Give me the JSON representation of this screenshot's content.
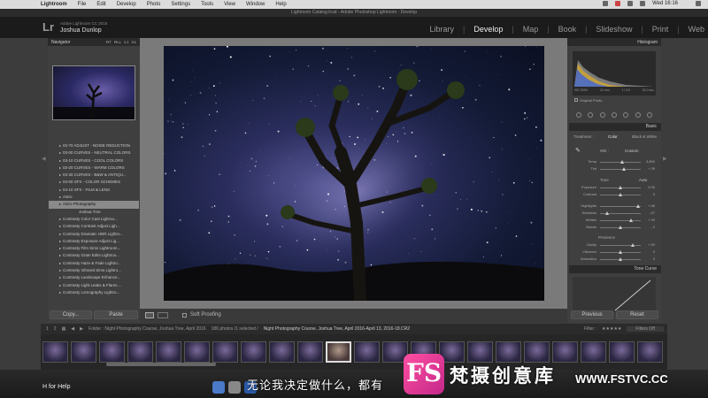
{
  "menubar": {
    "app": "Lightroom",
    "items": [
      "File",
      "Edit",
      "Develop",
      "Photo",
      "Settings",
      "Tools",
      "View",
      "Window",
      "Help"
    ],
    "clock": "Wed 16:16"
  },
  "titlebar": {
    "title": "Lightroom Catalog.lrcat - Adobe Photoshop Lightroom - Develop"
  },
  "identity": {
    "logo": "Lr",
    "product": "Adobe Lightroom CC 2015",
    "user": "Joshua Dunlop"
  },
  "modules": [
    {
      "label": "Library"
    },
    {
      "label": "Develop"
    },
    {
      "label": "Map"
    },
    {
      "label": "Book"
    },
    {
      "label": "Slideshow"
    },
    {
      "label": "Print"
    },
    {
      "label": "Web"
    }
  ],
  "navigator": {
    "title": "Navigator",
    "zoom_options": [
      "FIT",
      "FILL",
      "1:1",
      "3:1"
    ]
  },
  "presets": [
    {
      "label": "02-70 ADJUST - NOISE REDUCTION",
      "type": "folder"
    },
    {
      "label": "03-00 CURVES - NEUTRAL COLORS",
      "type": "folder"
    },
    {
      "label": "03-10 CURVES - COOL COLORS",
      "type": "folder"
    },
    {
      "label": "03-20 CURVES - WARM COLORS",
      "type": "folder"
    },
    {
      "label": "03-30 CURVES - B&W & ANTIQU...",
      "type": "folder"
    },
    {
      "label": "04-00 SFX - COLOR SCHEMES",
      "type": "folder"
    },
    {
      "label": "04-10 SFX - FILM & LENS",
      "type": "folder"
    },
    {
      "label": "Astro",
      "type": "folder"
    },
    {
      "label": "Astro Photography",
      "type": "selected"
    },
    {
      "label": "Joshua Tree",
      "type": "child"
    },
    {
      "label": "Contrasty Color Cast Lighroo...",
      "type": "folder"
    },
    {
      "label": "Contrasty Contrast Adjust Ligh...",
      "type": "folder"
    },
    {
      "label": "Contrasty Dramatic HDR Lightro...",
      "type": "folder"
    },
    {
      "label": "Contrasty Exposure Adjust Lig...",
      "type": "folder"
    },
    {
      "label": "Contrasty Film Sims Lightroom...",
      "type": "folder"
    },
    {
      "label": "Contrasty Grain Edits Lightroo...",
      "type": "folder"
    },
    {
      "label": "Contrasty Haze & Fade Lightro...",
      "type": "folder"
    },
    {
      "label": "Contrasty Infrared Sims Lightro...",
      "type": "folder"
    },
    {
      "label": "Contrasty Landscape Enhance...",
      "type": "folder"
    },
    {
      "label": "Contrasty Light Leaks & Flares ...",
      "type": "folder"
    },
    {
      "label": "Contrasty Lomography Lightro...",
      "type": "folder"
    }
  ],
  "left_buttons": {
    "copy": "Copy...",
    "paste": "Paste"
  },
  "toolbar": {
    "soft_proofing": "Soft Proofing"
  },
  "right": {
    "histogram_title": "Histogram",
    "hist_info": [
      "ISO 3200",
      "14 mm",
      "f / 2.8",
      "30.0 sec"
    ],
    "original_photo": "Original Photo",
    "basic_title": "Basic",
    "treatment_label": "Treatment :",
    "treatment_color": "Color",
    "treatment_bw": "Black & White",
    "wb_label": "WB :",
    "wb_value": "Custom",
    "tone_label": "Tone",
    "tone_auto": "Auto",
    "presence_label": "Presence",
    "tone_curve_title": "Tone Curve",
    "previous": "Previous",
    "reset": "Reset"
  },
  "sliders": [
    {
      "label": "Temp",
      "value": "3,800",
      "pos": 0.55
    },
    {
      "label": "Tint",
      "value": "+ 29",
      "pos": 0.58
    },
    {
      "label": "Exposure",
      "value": "0.00",
      "pos": 0.5
    },
    {
      "label": "Contrast",
      "value": "0",
      "pos": 0.5
    },
    {
      "label": "Highlights",
      "value": "+ 86",
      "pos": 0.93
    },
    {
      "label": "Shadows",
      "value": "- 67",
      "pos": 0.17
    },
    {
      "label": "Whites",
      "value": "+ 49",
      "pos": 0.75
    },
    {
      "label": "Blacks",
      "value": "- 2",
      "pos": 0.49
    },
    {
      "label": "Clarity",
      "value": "+ 60",
      "pos": 0.8
    },
    {
      "label": "Vibrance",
      "value": "0",
      "pos": 0.5
    },
    {
      "label": "Saturation",
      "value": "0",
      "pos": 0.5
    }
  ],
  "filmstrip": {
    "pages": [
      "1",
      "2"
    ],
    "source": "Folder : Night Photography Course, Joshua Tree, April 2016",
    "count": "186 photos /1 selected /",
    "filename": "Night Photography Course, Joshua Tree, April 2016-April 13, 2016-18.CR2",
    "filter_label": "Filter :",
    "filter_value": "Filters Off"
  },
  "status": {
    "help": "H for Help"
  },
  "subtitle": "无论我决定做什么，都有",
  "watermark": {
    "logo": "FS",
    "name": "梵摄创意库",
    "url": "WWW.FSTVC.CC"
  },
  "colors": {
    "accent": "#dddddd",
    "panel": "#3f3f3f",
    "watermark_pink": "#e8479a"
  }
}
